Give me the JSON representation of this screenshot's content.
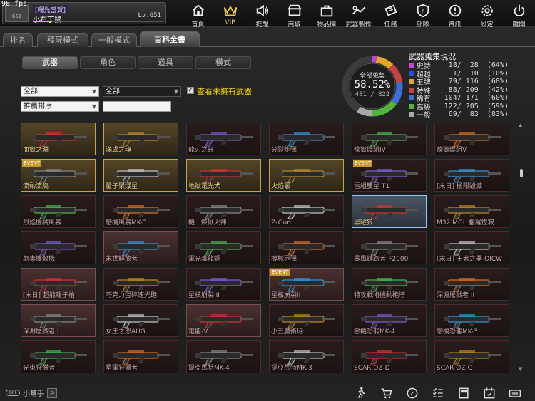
{
  "fps": "98 fps",
  "profile": {
    "avatar_text": "651",
    "guild": "[曙光盛賀]",
    "name": "小布丁鼠",
    "level": "Lv.651",
    "exp_fraction": 0.15
  },
  "nav": [
    {
      "label": "首頁",
      "icon": "home-icon"
    },
    {
      "label": "VIP",
      "icon": "crown-icon"
    },
    {
      "label": "提醒",
      "icon": "speaker-icon"
    },
    {
      "label": "商城",
      "icon": "shop-icon"
    },
    {
      "label": "物品欄",
      "icon": "bag-icon"
    },
    {
      "label": "武器製作",
      "icon": "craft-icon"
    },
    {
      "label": "任務",
      "icon": "ticket-icon"
    },
    {
      "label": "部隊",
      "icon": "shield-icon"
    },
    {
      "label": "資訊",
      "icon": "info-icon"
    },
    {
      "label": "設定",
      "icon": "gear-icon"
    },
    {
      "label": "離開",
      "icon": "power-icon"
    }
  ],
  "tabs": [
    "排名",
    "殭屍模式",
    "一般模式",
    "百科全書"
  ],
  "active_tab": "百科全書",
  "subtabs": [
    "武器",
    "角色",
    "道具",
    "模式"
  ],
  "filters": {
    "category": "全部",
    "type": "全部",
    "sort": "推薦排序",
    "search_value": "",
    "show_unowned_label": "查看未擁有武器",
    "show_unowned_checked": true
  },
  "collection": {
    "title": "全部蒐集",
    "percent": "58.52%",
    "count": "481 / 822"
  },
  "stats_title": "武器蒐集現況",
  "stats": [
    {
      "name": "史詩",
      "owned": 18,
      "total": 28,
      "pct": "(64%)",
      "color": "#c342e0"
    },
    {
      "name": "超越",
      "owned": 1,
      "total": 10,
      "pct": "(10%)",
      "color": "#2a4fd6"
    },
    {
      "name": "王牌",
      "owned": 79,
      "total": 116,
      "pct": "(68%)",
      "color": "#e6a623"
    },
    {
      "name": "特殊",
      "owned": 88,
      "total": 209,
      "pct": "(42%)",
      "color": "#c94343"
    },
    {
      "name": "稀有",
      "owned": 104,
      "total": 171,
      "pct": "(60%)",
      "color": "#3d6ee0"
    },
    {
      "name": "高級",
      "owned": 122,
      "total": 205,
      "pct": "(59%)",
      "color": "#53b33a"
    },
    {
      "name": "一般",
      "owned": 69,
      "total": 83,
      "pct": "(83%)",
      "color": "#aaaaaa"
    }
  ],
  "items": [
    {
      "name": "血獄之淵",
      "style": "owned",
      "event": ""
    },
    {
      "name": "滿盧之魂",
      "style": "owned",
      "event": ""
    },
    {
      "name": "龍刃之玨",
      "style": "plain",
      "event": ""
    },
    {
      "name": "分裂炸彈",
      "style": "plain",
      "event": ""
    },
    {
      "name": "煉獄爆組IV",
      "style": "plain",
      "event": ""
    },
    {
      "name": "煉獄爆組V",
      "style": "plain",
      "event": ""
    },
    {
      "name": "流動流觴",
      "style": "owned",
      "event": "EVENT"
    },
    {
      "name": "量子聚爆星",
      "style": "owned",
      "event": ""
    },
    {
      "name": "地獄電光犬",
      "style": "owned",
      "event": ""
    },
    {
      "name": "火焰霰",
      "style": "owned",
      "event": ""
    },
    {
      "name": "雷組雙星 T1",
      "style": "plain",
      "event": "EVENT"
    },
    {
      "name": "[末日] 極限毀滅",
      "style": "plain",
      "event": ""
    },
    {
      "name": "烈焰機械風暴",
      "style": "plain",
      "event": ""
    },
    {
      "name": "戀機風暴MK-3",
      "style": "plain",
      "event": ""
    },
    {
      "name": "機 · 煉獄火神",
      "style": "plain",
      "event": ""
    },
    {
      "name": "Z-Gun",
      "style": "plain",
      "event": ""
    },
    {
      "name": "黑曜狼",
      "style": "selected",
      "event": ""
    },
    {
      "name": "M32 MGL 翻羅恆寂",
      "style": "plain",
      "event": ""
    },
    {
      "name": "劇毒擴散機",
      "style": "plain",
      "event": ""
    },
    {
      "name": "末世解放者",
      "style": "pink",
      "event": ""
    },
    {
      "name": "電光毒龍鋼",
      "style": "plain",
      "event": ""
    },
    {
      "name": "機械砲彈",
      "style": "plain",
      "event": ""
    },
    {
      "name": "暴風鏈路者-F2000",
      "style": "plain",
      "event": ""
    },
    {
      "name": "[末日] 王者之器-OICW",
      "style": "plain",
      "event": ""
    },
    {
      "name": "[末日] 超能離子槍",
      "style": "pink",
      "event": ""
    },
    {
      "name": "巧克力蛋砰速光砲",
      "style": "plain",
      "event": ""
    },
    {
      "name": "星核崩裂III",
      "style": "plain",
      "event": ""
    },
    {
      "name": "星核崩裂II",
      "style": "pink",
      "event": "EVENT"
    },
    {
      "name": "特攻戰術機動砲塔",
      "style": "plain",
      "event": ""
    },
    {
      "name": "深淵屠戮者 II",
      "style": "plain",
      "event": ""
    },
    {
      "name": "深淵屠戮者 I",
      "style": "pink",
      "event": ""
    },
    {
      "name": "女王之怒AUG",
      "style": "plain",
      "event": ""
    },
    {
      "name": "電能-V",
      "style": "pink",
      "event": ""
    },
    {
      "name": "小丑魔術砲",
      "style": "plain",
      "event": ""
    },
    {
      "name": "戀機恐龍MK-4",
      "style": "plain",
      "event": ""
    },
    {
      "name": "戀機恐龍MK-3",
      "style": "plain",
      "event": ""
    },
    {
      "name": "光束狩獵者",
      "style": "plain",
      "event": ""
    },
    {
      "name": "星電狩獵者",
      "style": "plain",
      "event": ""
    },
    {
      "name": "提亞馬特MK-4",
      "style": "plain",
      "event": ""
    },
    {
      "name": "提亞馬特MK-3",
      "style": "plain",
      "event": ""
    },
    {
      "name": "SCAR OZ-D",
      "style": "plain",
      "event": ""
    },
    {
      "name": "SCAR OZ-C",
      "style": "plain",
      "event": ""
    }
  ],
  "bottom": {
    "helper_label": "小幫手",
    "toggle_text": "OFF",
    "icons": [
      "running-icon",
      "cart-icon",
      "compass-icon",
      "checklist-icon",
      "bookmark-icon",
      "calendar-icon",
      "ticket-icon"
    ]
  }
}
